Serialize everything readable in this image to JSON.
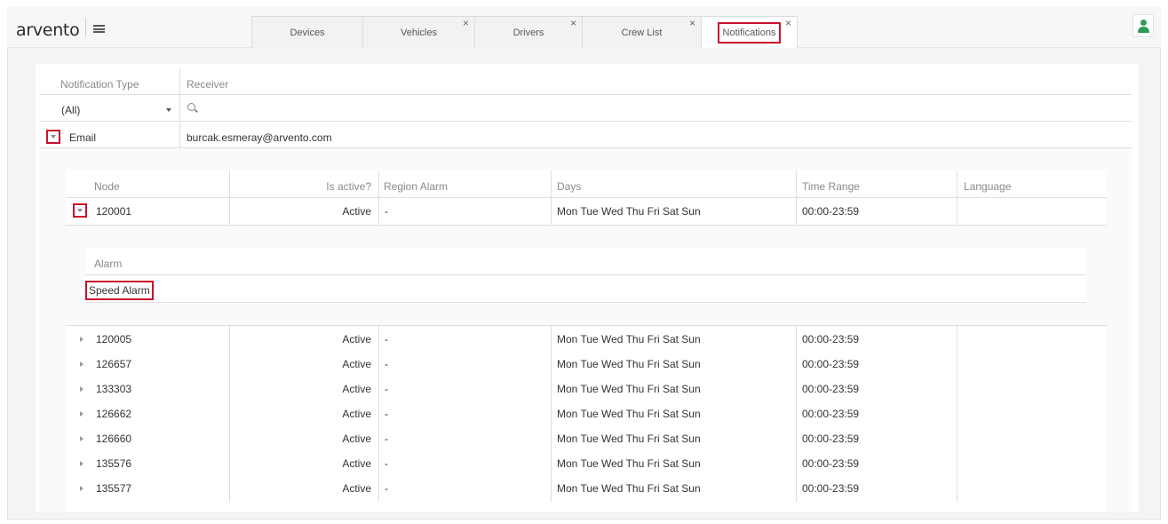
{
  "app": {
    "logo": "arvento"
  },
  "tabs": [
    {
      "label": "Devices",
      "closable": false,
      "active": false
    },
    {
      "label": "Vehicles",
      "closable": true,
      "active": false
    },
    {
      "label": "Drivers",
      "closable": true,
      "active": false
    },
    {
      "label": "Crew List",
      "closable": true,
      "active": false
    },
    {
      "label": "Notifications",
      "closable": true,
      "active": true
    }
  ],
  "colors": {
    "highlight": "#c8102e",
    "user_icon": "#2e9b57"
  },
  "notifications": {
    "columns": {
      "type": "Notification Type",
      "receiver": "Receiver"
    },
    "filter": {
      "type_value": "(All)",
      "receiver_value": ""
    },
    "row": {
      "type": "Email",
      "receiver": "burcak.esmeray@arvento.com"
    }
  },
  "nodes": {
    "columns": [
      "Node",
      "Is active?",
      "Region Alarm",
      "Days",
      "Time Range",
      "Language"
    ],
    "expanded": {
      "node": "120001",
      "active": "Active",
      "region": "-",
      "days": "Mon Tue Wed Thu Fri Sat Sun",
      "time": "00:00-23:59",
      "language": ""
    },
    "alarm_header": "Alarm",
    "alarm_value": "Speed Alarm",
    "rows": [
      {
        "node": "120005",
        "active": "Active",
        "region": "-",
        "days": "Mon Tue Wed Thu Fri Sat Sun",
        "time": "00:00-23:59"
      },
      {
        "node": "126657",
        "active": "Active",
        "region": "-",
        "days": "Mon Tue Wed Thu Fri Sat Sun",
        "time": "00:00-23:59"
      },
      {
        "node": "133303",
        "active": "Active",
        "region": "-",
        "days": "Mon Tue Wed Thu Fri Sat Sun",
        "time": "00:00-23:59"
      },
      {
        "node": "126662",
        "active": "Active",
        "region": "-",
        "days": "Mon Tue Wed Thu Fri Sat Sun",
        "time": "00:00-23:59"
      },
      {
        "node": "126660",
        "active": "Active",
        "region": "-",
        "days": "Mon Tue Wed Thu Fri Sat Sun",
        "time": "00:00-23:59"
      },
      {
        "node": "135576",
        "active": "Active",
        "region": "-",
        "days": "Mon Tue Wed Thu Fri Sat Sun",
        "time": "00:00-23:59"
      },
      {
        "node": "135577",
        "active": "Active",
        "region": "-",
        "days": "Mon Tue Wed Thu Fri Sat Sun",
        "time": "00:00-23:59"
      }
    ]
  }
}
